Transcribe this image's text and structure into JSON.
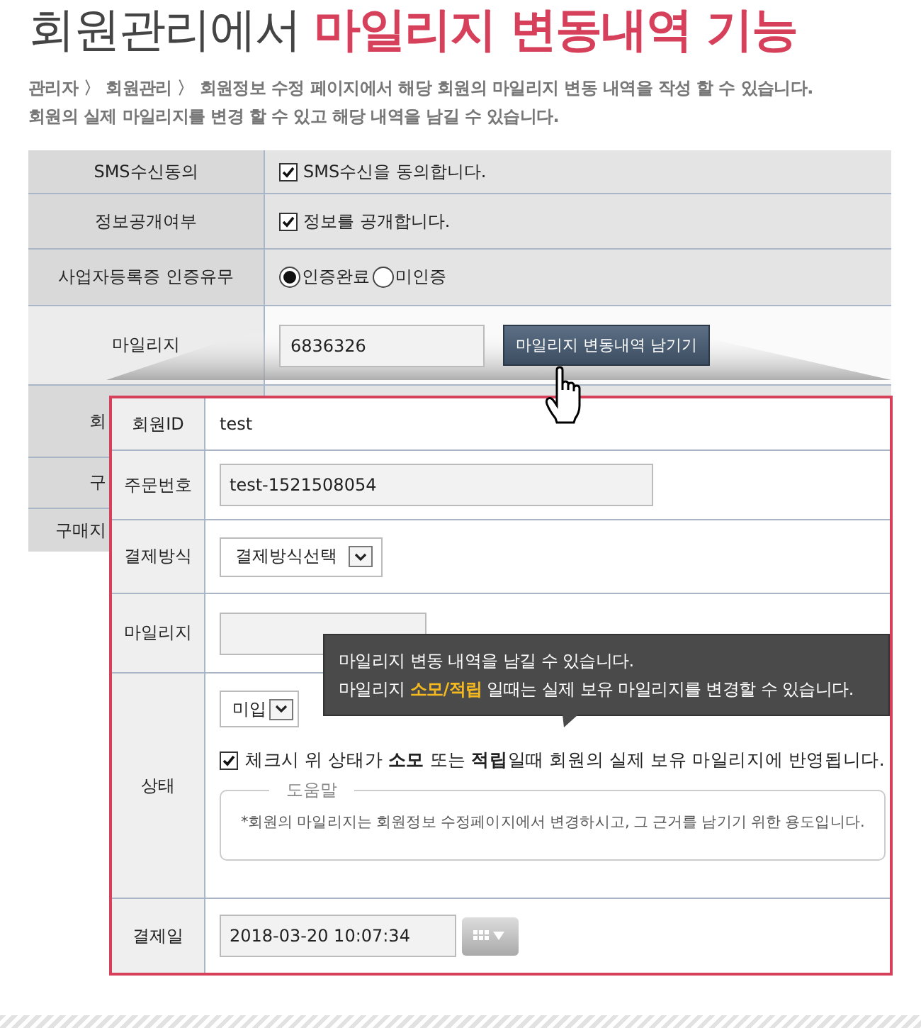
{
  "title": {
    "plain": "회원관리에서",
    "highlight": "마일리지 변동내역 기능"
  },
  "description": [
    "관리자 〉 회원관리 〉 회원정보 수정 페이지에서 해당 회원의 마일리지 변동 내역을 작성 할 수 있습니다.",
    "회원의 실제 마일리지를 변경 할 수 있고 해당 내역을 남길 수 있습니다."
  ],
  "member_form": {
    "rows": [
      {
        "label": "SMS수신동의",
        "kind": "checkbox",
        "checked": true,
        "text": "SMS수신을 동의합니다."
      },
      {
        "label": "정보공개여부",
        "kind": "checkbox",
        "checked": true,
        "text": "정보를 공개합니다."
      },
      {
        "label": "사업자등록증 인증유무",
        "kind": "radio",
        "options": [
          {
            "label": "인증완료",
            "selected": true
          },
          {
            "label": "미인증",
            "selected": false
          }
        ]
      },
      {
        "label": "마일리지",
        "kind": "mileage",
        "value": "6836326",
        "button": "마일리지 변동내역 남기기"
      },
      {
        "label": "회",
        "kind": "covered"
      },
      {
        "label": "구",
        "kind": "covered"
      },
      {
        "label": "구매지",
        "kind": "covered"
      }
    ]
  },
  "popup": {
    "rows": [
      {
        "label": "회원ID",
        "kind": "text",
        "value": "test"
      },
      {
        "label": "주문번호",
        "kind": "input",
        "value": "test-1521508054"
      },
      {
        "label": "결제방식",
        "kind": "select",
        "value": "결제방식선택"
      },
      {
        "label": "마일리지",
        "kind": "input"
      },
      {
        "label": "상태",
        "kind": "status",
        "select": "미입",
        "checked": true,
        "note": "체크시 위 상태가 **소모** 또는 **적립**일때 회원의 실제 보유 마일리지에 반영됩니다.",
        "help_title": "도움말",
        "help_text": "*회원의 마일리지는 회원정보 수정페이지에서 변경하시고, 그 근거를 남기기 위한 용도입니다."
      },
      {
        "label": "결제일",
        "kind": "date",
        "value": "2018-03-20 10:07:34"
      }
    ]
  },
  "tooltip": {
    "lines": [
      "마일리지 변동 내역을 남길 수 있습니다.",
      "마일리지 **소모/적립** 일때는 실제 보유 마일리지를 변경할 수 있습니다."
    ]
  }
}
